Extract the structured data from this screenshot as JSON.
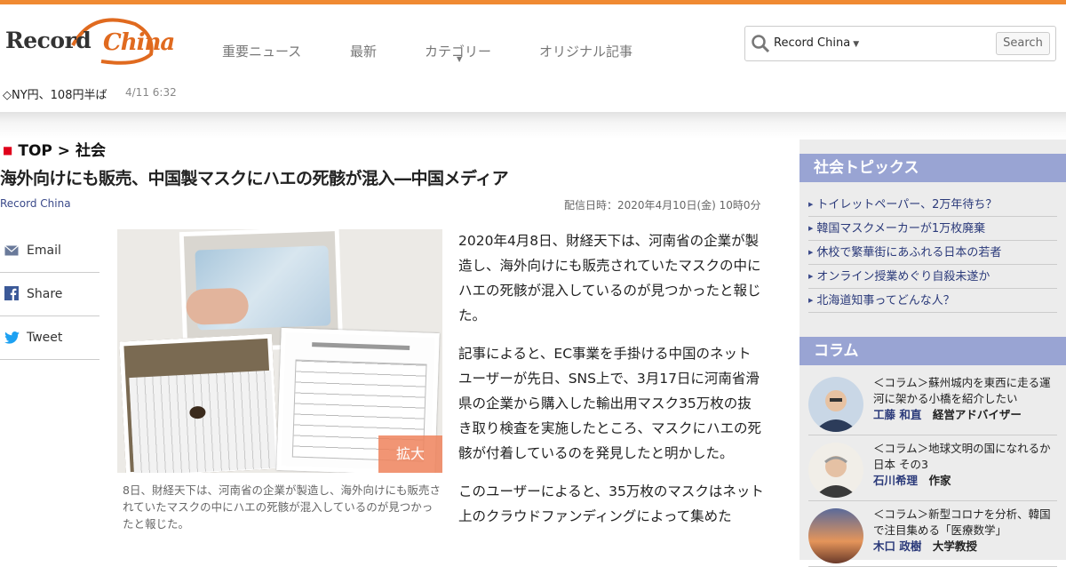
{
  "header": {
    "logo_part1": "Record",
    "logo_part2": "China",
    "nav": [
      "重要ニュース",
      "最新",
      "カテゴリー",
      "オリジナル記事"
    ],
    "search_scope": "Record China",
    "search_button": "Search",
    "accent_color": "#f08a32"
  },
  "ticker": {
    "text": "◇NY円、108円半ば",
    "time": "4/11 6:32"
  },
  "breadcrumb": {
    "top": "TOP",
    "sep": ">",
    "section": "社会"
  },
  "article": {
    "title": "海外向けにも販売、中国製マスクにハエの死骸が混入―中国メディア",
    "source": "Record China",
    "date": "配信日時：2020年4月10日(金) 10時0分",
    "zoom_label": "拡大",
    "caption": "8日、財経天下は、河南省の企業が製造し、海外向けにも販売されていたマスクの中にハエの死骸が混入しているのが見つかったと報じた。",
    "paragraphs": [
      "2020年4月8日、財経天下は、河南省の企業が製造し、海外向けにも販売されていたマスクの中にハエの死骸が混入しているのが見つかったと報じた。",
      "記事によると、EC事業を手掛ける中国のネットユーザーが先日、SNS上で、3月17日に河南省滑県の企業から購入した輸出用マスク35万枚の抜き取り検査を実施したところ、マスクにハエの死骸が付着しているのを発見したと明かした。",
      "このユーザーによると、35万枚のマスクはネット上のクラウドファンディングによって集めた"
    ]
  },
  "share": [
    {
      "label": "Email",
      "icon": "email-icon"
    },
    {
      "label": "Share",
      "icon": "facebook-icon"
    },
    {
      "label": "Tweet",
      "icon": "twitter-icon"
    }
  ],
  "sidebar": {
    "topics_heading": "社会トピックス",
    "topics": [
      "トイレットペーパー、2万年待ち？",
      "韓国マスクメーカーが1万枚廃棄",
      "休校で繁華街にあふれる日本の若者",
      "オンライン授業めぐり自殺未遂か",
      "北海道知事ってどんな人？"
    ],
    "column_heading": "コラム",
    "columns": [
      {
        "title": "＜コラム＞蘇州城内を東西に走る運河に架かる小橋を紹介したい",
        "author": "工藤 和直",
        "role": "経営アドバイザー"
      },
      {
        "title": "＜コラム＞地球文明の国になれるか日本 その3",
        "author": "石川希理",
        "role": "作家"
      },
      {
        "title": "＜コラム＞新型コロナを分析、韓国で注目集める「医療数学」",
        "author": "木口 政樹",
        "role": "大学教授"
      }
    ],
    "heading_color": "#99a4d3"
  }
}
